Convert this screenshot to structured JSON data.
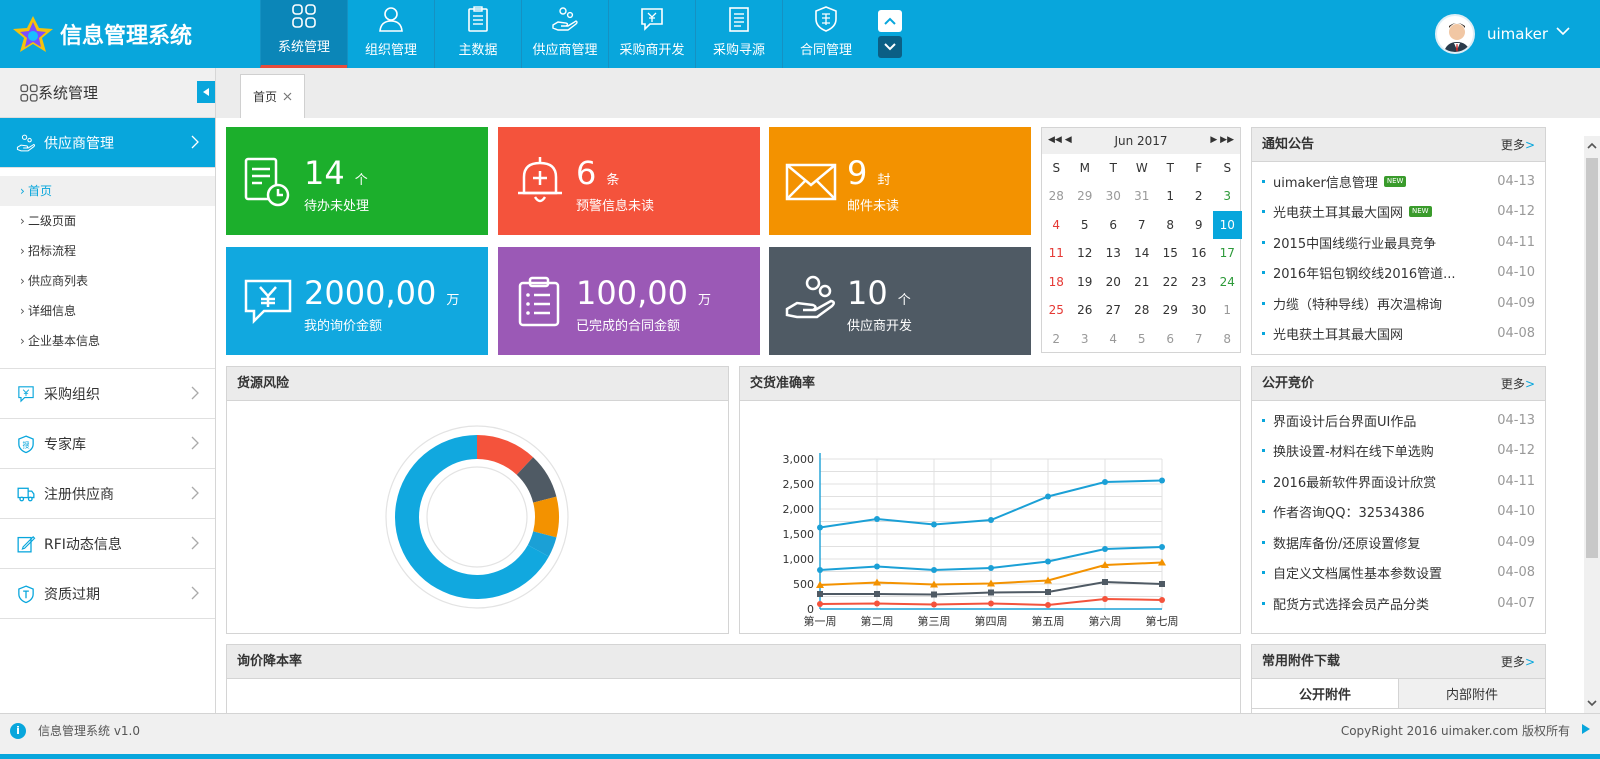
{
  "app": {
    "title": "信息管理系统",
    "version": "信息管理系统 v1.0",
    "copyright": "CopyRight 2016 uimaker.com 版权所有"
  },
  "nav": [
    {
      "label": "系统管理",
      "icon": "grid-icon"
    },
    {
      "label": "组织管理",
      "icon": "person-icon"
    },
    {
      "label": "主数据",
      "icon": "clipboard-icon"
    },
    {
      "label": "供应商管理",
      "icon": "hand-coins-icon"
    },
    {
      "label": "采购商开发",
      "icon": "yen-bubble-icon"
    },
    {
      "label": "采购寻源",
      "icon": "document-list-icon"
    },
    {
      "label": "合同管理",
      "icon": "quality-badge-icon"
    }
  ],
  "user": {
    "name": "uimaker"
  },
  "sidebar": {
    "title": "系统管理",
    "groups": [
      {
        "label": "供应商管理",
        "icon": "hand-coins-icon"
      },
      {
        "label": "采购组织",
        "icon": "yen-bubble-icon"
      },
      {
        "label": "专家库",
        "icon": "shield-icon"
      },
      {
        "label": "注册供应商",
        "icon": "truck-icon"
      },
      {
        "label": "RFI动态信息",
        "icon": "edit-icon"
      },
      {
        "label": "资质过期",
        "icon": "shield-t-icon"
      }
    ],
    "sub_items": [
      "首页",
      "二级页面",
      "招标流程",
      "供应商列表",
      "详细信息",
      "企业基本信息"
    ]
  },
  "tab": {
    "label": "首页"
  },
  "tiles": [
    {
      "num": "14",
      "unit": "个",
      "label": "待办未处理",
      "color": "#1caf2c"
    },
    {
      "num": "6",
      "unit": "条",
      "label": "预警信息未读",
      "color": "#f4533c"
    },
    {
      "num": "9",
      "unit": "封",
      "label": "邮件未读",
      "color": "#f39200"
    },
    {
      "num": "2000,00",
      "unit": "万",
      "label": "我的询价金额",
      "color": "#11a8df"
    },
    {
      "num": "100,00",
      "unit": "万",
      "label": "已完成的合同金额",
      "color": "#9b59b6"
    },
    {
      "num": "10",
      "unit": "个",
      "label": "供应商开发",
      "color": "#4f5a64"
    }
  ],
  "calendar": {
    "title": "Jun 2017",
    "weekdays": [
      "S",
      "M",
      "T",
      "W",
      "T",
      "F",
      "S"
    ],
    "days": [
      [
        "28",
        "29",
        "30",
        "31",
        "1",
        "2",
        "3"
      ],
      [
        "4",
        "5",
        "6",
        "7",
        "8",
        "9",
        "10"
      ],
      [
        "11",
        "12",
        "13",
        "14",
        "15",
        "16",
        "17"
      ],
      [
        "18",
        "19",
        "20",
        "21",
        "22",
        "23",
        "24"
      ],
      [
        "25",
        "26",
        "27",
        "28",
        "29",
        "30",
        "1"
      ],
      [
        "2",
        "3",
        "4",
        "5",
        "6",
        "7",
        "8"
      ]
    ],
    "selected": "10"
  },
  "notice": {
    "title": "通知公告",
    "more": "更多",
    "items": [
      {
        "text": "uimaker信息管理",
        "date": "04-13",
        "new": "NEW"
      },
      {
        "text": "光电获土耳其最大国网",
        "date": "04-12",
        "new": "NEW"
      },
      {
        "text": "2015中国线缆行业最具竞争",
        "date": "04-11"
      },
      {
        "text": "2016年铝包钢绞线2016管道...",
        "date": "04-10"
      },
      {
        "text": "力缆（特种导线）再次温棉询",
        "date": "04-09"
      },
      {
        "text": "光电获土耳其最大国网",
        "date": "04-08"
      }
    ]
  },
  "bidding": {
    "title": "公开竞价",
    "more": "更多",
    "items": [
      {
        "text": "界面设计后台界面UI作品",
        "date": "04-13"
      },
      {
        "text": "换肤设置-材料在线下单选购",
        "date": "04-12"
      },
      {
        "text": "2016最新软件界面设计欣赏",
        "date": "04-11"
      },
      {
        "text": "作者咨询QQ：32534386",
        "date": "04-10"
      },
      {
        "text": "数据库备份/还原设置修复",
        "date": "04-09"
      },
      {
        "text": "自定义文档属性基本参数设置",
        "date": "04-08"
      },
      {
        "text": "配货方式选择会员产品分类",
        "date": "04-07"
      }
    ]
  },
  "downloads": {
    "title": "常用附件下载",
    "more": "更多",
    "tabs": [
      "公开附件",
      "内部附件"
    ]
  },
  "panels": {
    "risk": "货源风险",
    "accuracy": "交货准确率",
    "reduction": "询价降本率"
  },
  "chart_data": [
    {
      "type": "pie",
      "title": "",
      "values": [
        12,
        9,
        8,
        4,
        67
      ],
      "colors": [
        "#f4533c",
        "#4f5a64",
        "#f39200",
        "#1ba0d6",
        "#11a8df"
      ]
    },
    {
      "type": "line",
      "title": "",
      "categories": [
        "第一周",
        "第二周",
        "第三周",
        "第四周",
        "第五周",
        "第六周",
        "第七周"
      ],
      "ylim": [
        0,
        3000
      ],
      "yticks": [
        "0",
        "250",
        "500",
        "750",
        "1,000",
        "1,250",
        "1,500",
        "1,750",
        "2,000",
        "2,250",
        "2,500",
        "2,750",
        "3,000"
      ],
      "series": [
        {
          "values": [
            1630,
            1800,
            1690,
            1780,
            2250,
            2540,
            2570
          ],
          "color": "#1ba0d6",
          "marker": "circle"
        },
        {
          "values": [
            780,
            850,
            780,
            820,
            950,
            1200,
            1240
          ],
          "color": "#1ba0d6",
          "marker": "circle"
        },
        {
          "values": [
            480,
            530,
            490,
            510,
            570,
            880,
            930
          ],
          "color": "#f39200",
          "marker": "triangle"
        },
        {
          "values": [
            300,
            300,
            290,
            330,
            340,
            540,
            500
          ],
          "color": "#4f5a64",
          "marker": "square"
        },
        {
          "values": [
            100,
            110,
            90,
            110,
            80,
            200,
            180
          ],
          "color": "#f4533c",
          "marker": "circle"
        }
      ],
      "grid": true
    }
  ]
}
